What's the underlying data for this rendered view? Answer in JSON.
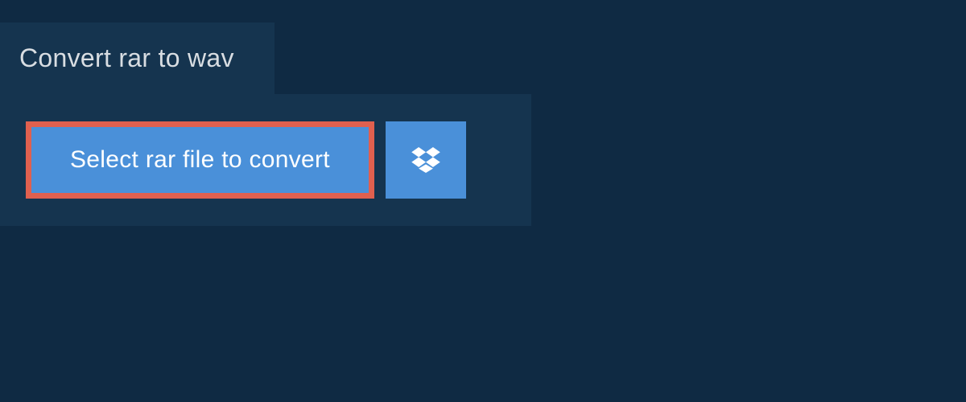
{
  "tab": {
    "title": "Convert rar to wav"
  },
  "actions": {
    "select_file_label": "Select rar file to convert"
  },
  "colors": {
    "page_bg": "#0f2a43",
    "panel_bg": "#15344f",
    "button_bg": "#4a90d9",
    "highlight_border": "#e0604f",
    "text_light": "#ffffff",
    "text_muted": "#d8dde2"
  }
}
